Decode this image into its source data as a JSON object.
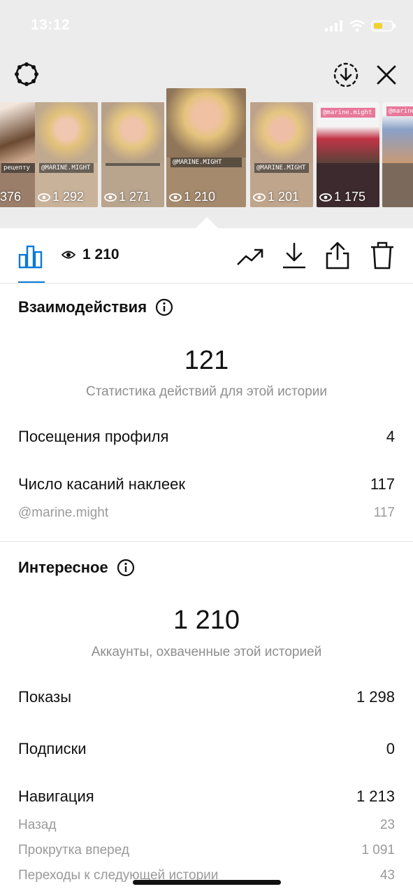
{
  "status_bar": {
    "time": "13:12"
  },
  "thumbnails": [
    {
      "views": "376",
      "caption": "рецепту"
    },
    {
      "views": "1 292",
      "caption": "@MARINE.MIGHT"
    },
    {
      "views": "1 271",
      "caption": ""
    },
    {
      "views": "1 210",
      "caption": "@MARINE.MIGHT"
    },
    {
      "views": "1 201",
      "caption": "@MARINE.MIGHT"
    },
    {
      "views": "1 175",
      "caption": "@marine.might"
    },
    {
      "views": "",
      "caption": "@marine.might"
    }
  ],
  "toolbar": {
    "view_count": "1 210"
  },
  "interactions": {
    "title": "Взаимодействия",
    "total": "121",
    "subtitle": "Статистика действий для этой истории",
    "rows": [
      {
        "label": "Посещения профиля",
        "value": "4"
      },
      {
        "label": "Число касаний наклеек",
        "value": "117"
      }
    ],
    "sub_rows": [
      {
        "label": "@marine.might",
        "value": "117"
      }
    ]
  },
  "discovery": {
    "title": "Интересное",
    "total": "1 210",
    "subtitle": "Аккаунты, охваченные этой историей",
    "rows": [
      {
        "label": "Показы",
        "value": "1 298"
      },
      {
        "label": "Подписки",
        "value": "0"
      },
      {
        "label": "Навигация",
        "value": "1 213"
      }
    ],
    "sub_rows": [
      {
        "label": "Назад",
        "value": "23"
      },
      {
        "label": "Прокрутка вперед",
        "value": "1 091"
      },
      {
        "label": "Переходы к следующей истории",
        "value": "43"
      }
    ]
  },
  "colors": {
    "accent": "#0a7ad6",
    "muted": "#8e8e8e"
  }
}
